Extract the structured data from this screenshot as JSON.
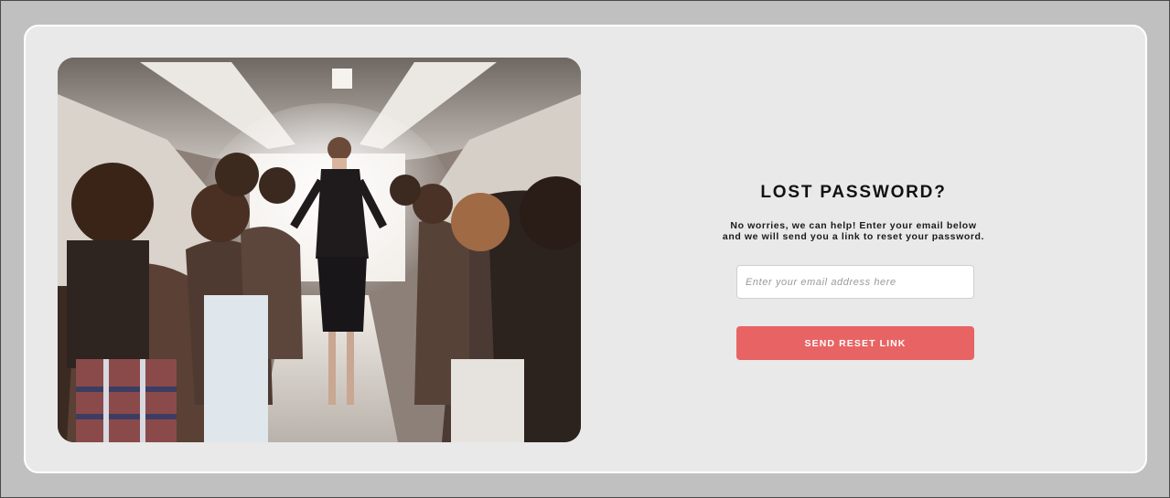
{
  "forgot_password": {
    "title": "LOST PASSWORD?",
    "description_line1": "No worries, we can help! Enter your email below",
    "description_line2": "and we will send you a link to reset your password.",
    "email_placeholder": "Enter your email address here",
    "email_value": "",
    "submit_label": "SEND RESET LINK"
  },
  "colors": {
    "page_background": "#c0c0c0",
    "card_background": "#e9e9e9",
    "button_accent": "#e86464"
  },
  "photo": {
    "subject": "bus-interior-with-passengers-and-guide"
  }
}
